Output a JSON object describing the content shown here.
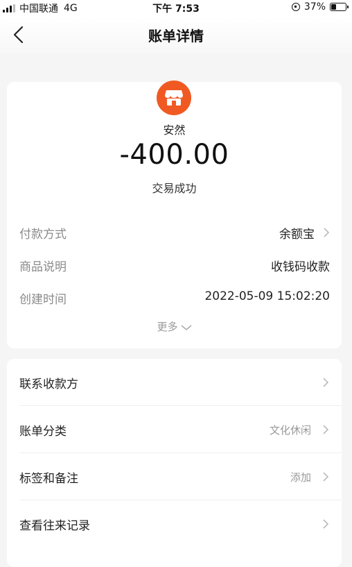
{
  "status_bar": {
    "carrier": "中国联通",
    "network": "4G",
    "time": "下午 7:53",
    "battery_percent_label": "37%",
    "battery_level": 0.37
  },
  "nav": {
    "title": "账单详情"
  },
  "transaction": {
    "name": "安然",
    "amount": "-400.00",
    "status": "交易成功",
    "icon": "store-icon",
    "icon_color": "#f05a22"
  },
  "details": [
    {
      "label": "付款方式",
      "value": "余额宝",
      "has_arrow": true
    },
    {
      "label": "商品说明",
      "value": "收钱码收款",
      "has_arrow": false
    },
    {
      "label": "创建时间",
      "value": "2022-05-09 15:02:20",
      "has_arrow": false
    }
  ],
  "more_label": "更多",
  "actions": [
    {
      "label": "联系收款方",
      "value": ""
    },
    {
      "label": "账单分类",
      "value": "文化休闲"
    },
    {
      "label": "标签和备注",
      "value": "添加"
    },
    {
      "label": "查看往来记录",
      "value": ""
    }
  ]
}
